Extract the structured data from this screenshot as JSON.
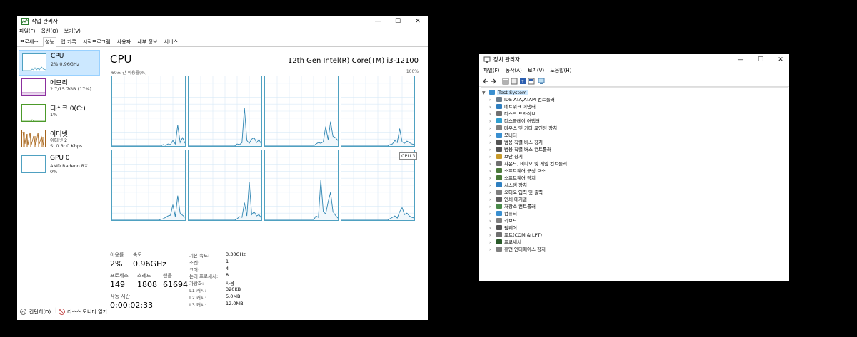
{
  "task_manager": {
    "title": "작업 관리자",
    "menu": [
      "파일(F)",
      "옵션(O)",
      "보기(V)"
    ],
    "tabs": [
      "프로세스",
      "성능",
      "앱 기록",
      "시작프로그램",
      "사용자",
      "세부 정보",
      "서비스"
    ],
    "active_tab": "성능",
    "sidebar": [
      {
        "name": "CPU",
        "line1": "2% 0.96GHz",
        "line2": "",
        "color": "#4fa1c1"
      },
      {
        "name": "메모리",
        "line1": "2.7/15.7GB (17%)",
        "line2": "",
        "color": "#8b2f9e"
      },
      {
        "name": "디스크 0(C:)",
        "line1": "1%",
        "line2": "",
        "color": "#4c9a2a"
      },
      {
        "name": "이더넷",
        "line1": "이더넷 2",
        "line2": "S:  0  R:  0 Kbps",
        "color": "#a4641d"
      },
      {
        "name": "GPU 0",
        "line1": "AMD Radeon RX ...",
        "line2": "0%",
        "color": "#4fa1c1"
      }
    ],
    "main": {
      "title": "CPU",
      "model": "12th Gen Intel(R) Core(TM) i3-12100",
      "ylabel": "60초 간 이용률(%)",
      "ymax": "100%",
      "tooltip": "CPU 3",
      "stats": {
        "usage_label": "이용률",
        "usage_value": "2%",
        "speed_label": "속도",
        "speed_value": "0.96GHz",
        "processes_label": "프로세스",
        "processes_value": "149",
        "threads_label": "스레드",
        "threads_value": "1808",
        "handles_label": "핸들",
        "handles_value": "61694",
        "uptime_label": "작동 시간",
        "uptime_value": "0:00:02:33"
      },
      "right_stats": [
        {
          "label": "기본 속도:",
          "value": "3.30GHz"
        },
        {
          "label": "소켓:",
          "value": "1"
        },
        {
          "label": "코어:",
          "value": "4"
        },
        {
          "label": "논리 프로세서:",
          "value": "8"
        },
        {
          "label": "가상화:",
          "value": "사용"
        },
        {
          "label": "L1 캐시:",
          "value": "320KB"
        },
        {
          "label": "L2 캐시:",
          "value": "5.0MB"
        },
        {
          "label": "L3 캐시:",
          "value": "12.0MB"
        }
      ]
    },
    "footer": {
      "collapse": "간단히(D)",
      "resmon": "리소스 모니터 열기"
    }
  },
  "device_manager": {
    "title": "장치 관리자",
    "menu": [
      "파일(F)",
      "동작(A)",
      "보기(V)",
      "도움말(H)"
    ],
    "root": "Test-System",
    "items": [
      {
        "label": "IDE ATA/ATAPI 컨트롤러",
        "color": "#6a7c8c"
      },
      {
        "label": "네트워크 어댑터",
        "color": "#2f7fc0"
      },
      {
        "label": "디스크 드라이브",
        "color": "#707070"
      },
      {
        "label": "디스플레이 어댑터",
        "color": "#2f9fd0"
      },
      {
        "label": "마우스 및 기타 포인팅 장치",
        "color": "#808080"
      },
      {
        "label": "모니터",
        "color": "#3a8fd0"
      },
      {
        "label": "범용 직렬 버스 장치",
        "color": "#555555"
      },
      {
        "label": "범용 직렬 버스 컨트롤러",
        "color": "#555555"
      },
      {
        "label": "보안 장치",
        "color": "#c89a2a"
      },
      {
        "label": "사운드, 비디오 및 게임 컨트롤러",
        "color": "#707070"
      },
      {
        "label": "소프트웨어 구성 요소",
        "color": "#4a7a3a"
      },
      {
        "label": "소프트웨어 장치",
        "color": "#4a7a3a"
      },
      {
        "label": "시스템 장치",
        "color": "#2f7fc0"
      },
      {
        "label": "오디오 입력 및 출력",
        "color": "#808080"
      },
      {
        "label": "인쇄 대기열",
        "color": "#606060"
      },
      {
        "label": "저장소 컨트롤러",
        "color": "#4a8a4a"
      },
      {
        "label": "컴퓨터",
        "color": "#3a8fd0"
      },
      {
        "label": "키보드",
        "color": "#808080"
      },
      {
        "label": "펌웨어",
        "color": "#555555"
      },
      {
        "label": "포트(COM & LPT)",
        "color": "#707070"
      },
      {
        "label": "프로세서",
        "color": "#2a5a2a"
      },
      {
        "label": "휴먼 인터페이스 장치",
        "color": "#808080"
      }
    ]
  },
  "chart_data": {
    "type": "line",
    "title": "CPU",
    "ylabel": "60초 간 이용률(%)",
    "ylim": [
      0,
      100
    ],
    "x": [
      0,
      2,
      4,
      6,
      8,
      10,
      12,
      14,
      16,
      18,
      20,
      22,
      24,
      26,
      28,
      30,
      32,
      34,
      36,
      38,
      40,
      42,
      44,
      46,
      48,
      50,
      52,
      54,
      56,
      58,
      60
    ],
    "series": [
      {
        "values": [
          0,
          0,
          0,
          0,
          0,
          0,
          0,
          0,
          0,
          0,
          0,
          0,
          0,
          0,
          0,
          0,
          0,
          0,
          0,
          0,
          0,
          2,
          1,
          3,
          2,
          8,
          3,
          30,
          5,
          12,
          4
        ]
      },
      {
        "values": [
          0,
          0,
          0,
          0,
          0,
          0,
          0,
          0,
          0,
          0,
          0,
          0,
          0,
          0,
          0,
          0,
          0,
          0,
          0,
          0,
          3,
          2,
          5,
          55,
          8,
          4,
          10,
          12,
          5,
          9,
          3
        ]
      },
      {
        "values": [
          0,
          0,
          0,
          0,
          0,
          0,
          0,
          0,
          0,
          0,
          0,
          0,
          0,
          0,
          0,
          0,
          0,
          0,
          0,
          0,
          0,
          3,
          5,
          4,
          6,
          28,
          9,
          35,
          14,
          12,
          8
        ]
      },
      {
        "values": [
          0,
          0,
          0,
          0,
          0,
          0,
          0,
          0,
          0,
          0,
          0,
          0,
          0,
          0,
          0,
          0,
          0,
          0,
          0,
          0,
          2,
          3,
          8,
          5,
          25,
          6,
          4,
          7,
          5,
          3,
          2
        ]
      },
      {
        "values": [
          0,
          0,
          0,
          0,
          0,
          0,
          0,
          0,
          0,
          0,
          0,
          0,
          0,
          0,
          0,
          0,
          0,
          0,
          0,
          0,
          1,
          2,
          4,
          6,
          7,
          22,
          5,
          35,
          10,
          7,
          4
        ]
      },
      {
        "values": [
          0,
          0,
          0,
          0,
          0,
          0,
          0,
          0,
          0,
          0,
          0,
          0,
          0,
          0,
          0,
          0,
          0,
          0,
          0,
          0,
          2,
          5,
          4,
          25,
          6,
          55,
          8,
          12,
          6,
          8,
          3
        ]
      },
      {
        "values": [
          0,
          0,
          0,
          0,
          0,
          0,
          0,
          0,
          0,
          0,
          0,
          0,
          0,
          0,
          0,
          0,
          0,
          0,
          0,
          0,
          0,
          6,
          4,
          58,
          12,
          9,
          26,
          40,
          12,
          7,
          3
        ]
      },
      {
        "values": [
          0,
          0,
          0,
          0,
          0,
          0,
          0,
          0,
          0,
          0,
          0,
          0,
          0,
          0,
          0,
          0,
          0,
          0,
          0,
          0,
          2,
          4,
          6,
          3,
          12,
          18,
          8,
          10,
          6,
          4,
          3
        ]
      }
    ]
  }
}
